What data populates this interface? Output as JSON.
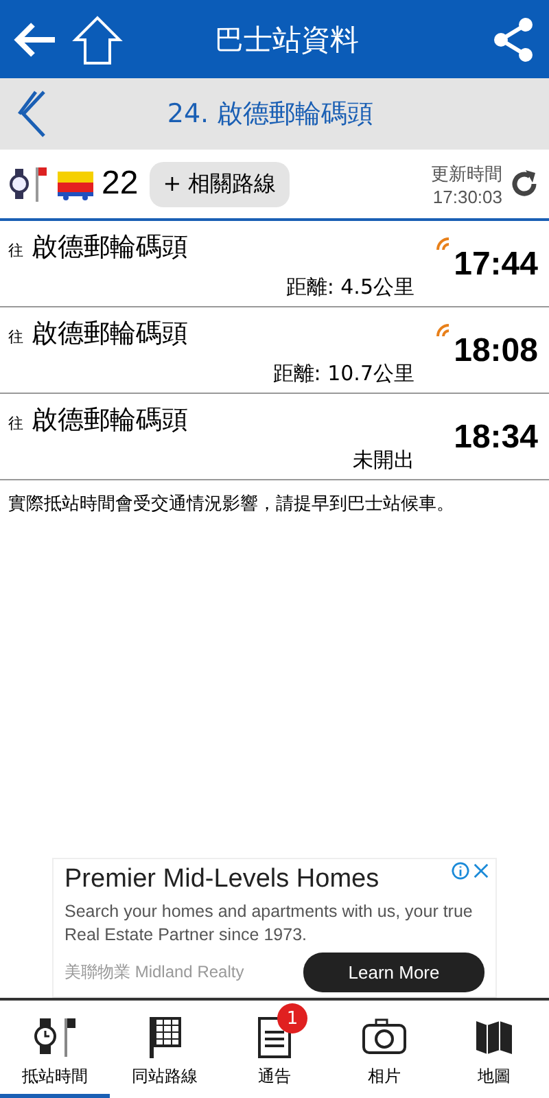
{
  "header": {
    "title": "巴士站資料"
  },
  "stop": {
    "title": "24. 啟德郵輪碼頭"
  },
  "route": {
    "number": "22",
    "related_button": "+ 相關路線",
    "update_label": "更新時間",
    "update_time": "17:30:03"
  },
  "arrivals": [
    {
      "prefix": "往",
      "destination": "啟德郵輪碼頭",
      "info": "距離: 4.5公里",
      "time": "17:44",
      "live": true
    },
    {
      "prefix": "往",
      "destination": "啟德郵輪碼頭",
      "info": "距離: 10.7公里",
      "time": "18:08",
      "live": true
    },
    {
      "prefix": "往",
      "destination": "啟德郵輪碼頭",
      "info": "未開出",
      "time": "18:34",
      "live": false
    }
  ],
  "notice": "實際抵站時間會受交通情況影響，請提早到巴士站候車。",
  "ad": {
    "title": "Premier Mid-Levels Homes",
    "body": "Search your homes and apartments with us, your true Real Estate Partner since 1973.",
    "advertiser": "美聯物業 Midland Realty",
    "button": "Learn More"
  },
  "tabs": [
    {
      "kind": "eta",
      "label": "抵站時間",
      "selected": true
    },
    {
      "kind": "routes",
      "label": "同站路線",
      "selected": false
    },
    {
      "kind": "notice",
      "label": "通告",
      "selected": false,
      "badge": "1"
    },
    {
      "kind": "photo",
      "label": "相片",
      "selected": false
    },
    {
      "kind": "map",
      "label": "地圖",
      "selected": false
    }
  ]
}
